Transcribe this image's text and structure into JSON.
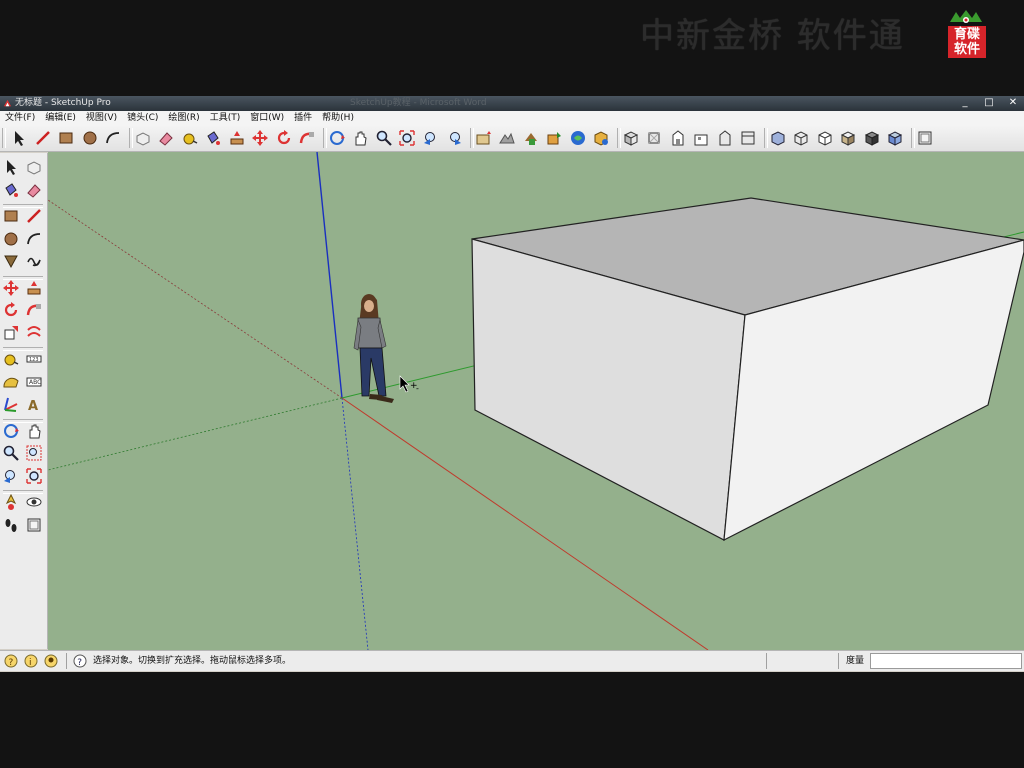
{
  "watermark": {
    "brand_text": "中新金桥 软件通",
    "logo_line1": "育碟",
    "logo_line2": "软件"
  },
  "window": {
    "title": "无标题 - SketchUp Pro",
    "background_title": "SketchUp教程 - Microsoft Word",
    "min": "_",
    "max": "□",
    "close": "✕"
  },
  "menu": [
    "文件(F)",
    "编辑(E)",
    "视图(V)",
    "镜头(C)",
    "绘图(R)",
    "工具(T)",
    "窗口(W)",
    "插件",
    "帮助(H)"
  ],
  "toolbar_icons": [
    "select-icon",
    "line-icon",
    "rectangle-icon",
    "circle-icon",
    "arc-icon",
    "make-component-icon",
    "eraser-icon",
    "tape-measure-icon",
    "paint-bucket-icon",
    "push-pull-icon",
    "move-icon",
    "rotate-icon",
    "follow-me-icon",
    "orbit-icon",
    "pan-icon",
    "zoom-icon",
    "zoom-extents-icon",
    "previous-view-icon",
    "next-view-icon",
    "add-location-icon",
    "toggle-terrain-icon",
    "get-models-icon",
    "share-model-icon",
    "share-component-icon",
    "dynamic-components-icon",
    "iso-view-icon",
    "top-view-icon",
    "front-view-icon",
    "right-view-icon",
    "back-view-icon",
    "left-view-icon",
    "xray-icon",
    "wireframe-icon",
    "hidden-line-icon",
    "shaded-icon",
    "shaded-textures-icon",
    "monochrome-icon",
    "section-plane-icon"
  ],
  "left_tools": [
    [
      "select-icon",
      "make-component-icon"
    ],
    [
      "paint-bucket-icon",
      "eraser-icon"
    ],
    [
      "rectangle-icon",
      "line-icon"
    ],
    [
      "circle-icon",
      "arc-icon"
    ],
    [
      "polygon-icon",
      "freehand-icon"
    ],
    [
      "move-icon",
      "push-pull-icon"
    ],
    [
      "rotate-icon",
      "follow-me-icon"
    ],
    [
      "scale-icon",
      "offset-icon"
    ],
    [
      "tape-measure-icon",
      "dimension-icon"
    ],
    [
      "protractor-icon",
      "text-icon"
    ],
    [
      "axes-icon",
      "3d-text-icon"
    ],
    [
      "orbit-icon",
      "pan-icon"
    ],
    [
      "zoom-icon",
      "zoom-window-icon"
    ],
    [
      "previous-view-icon",
      "zoom-extents-icon"
    ],
    [
      "position-camera-icon",
      "look-around-icon"
    ],
    [
      "walk-icon",
      "section-plane-icon"
    ]
  ],
  "status": {
    "hint": "选择对象。切换到扩充选择。拖动鼠标选择多项。",
    "measure_label": "度量",
    "measure_value": ""
  },
  "colors": {
    "viewport_bg": "#94b08c",
    "box_top": "#b5b5b5",
    "box_front": "#dedede",
    "box_side": "#f2f2f2",
    "axis_red": "#c0392b",
    "axis_green": "#2e9a2e",
    "axis_blue": "#1a2fbf"
  }
}
